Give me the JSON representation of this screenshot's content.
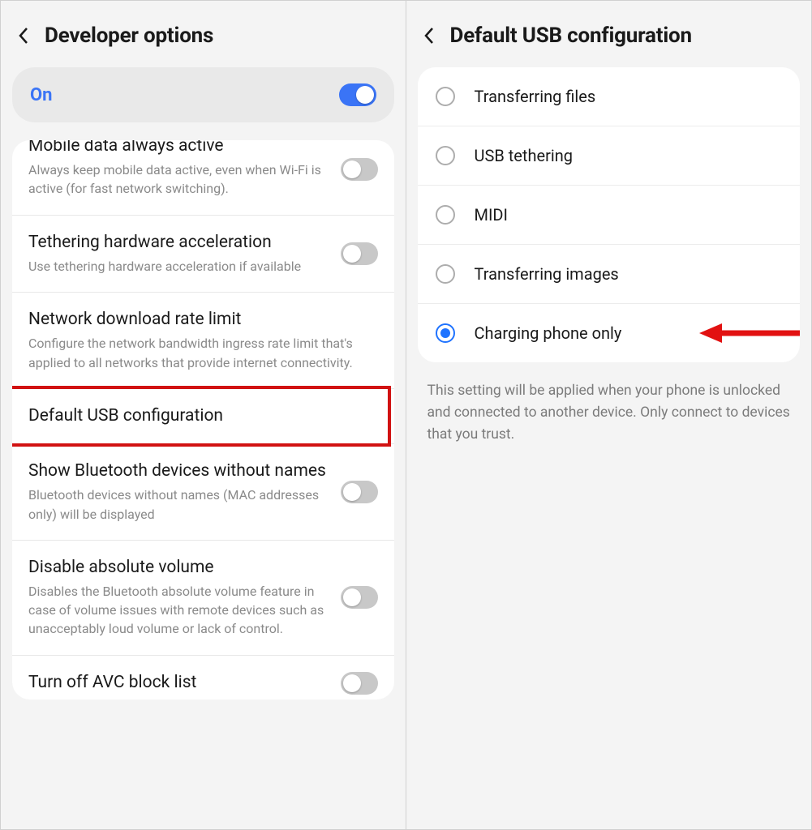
{
  "left": {
    "title": "Developer options",
    "on_label": "On",
    "on_state": true,
    "rows": {
      "mobile_data": {
        "title": "Mobile data always active",
        "sub": "Always keep mobile data active, even when Wi-Fi is active (for fast network switching).",
        "toggle": false
      },
      "tether_accel": {
        "title": "Tethering hardware acceleration",
        "sub": "Use tethering hardware acceleration if available",
        "toggle": false
      },
      "net_rate": {
        "title": "Network download rate limit",
        "sub": "Configure the network bandwidth ingress rate limit that's applied to all networks that provide internet connectivity."
      },
      "default_usb": {
        "title": "Default USB configuration"
      },
      "bt_noname": {
        "title": "Show Bluetooth devices without names",
        "sub": "Bluetooth devices without names (MAC addresses only) will be displayed",
        "toggle": false
      },
      "abs_vol": {
        "title": "Disable absolute volume",
        "sub": "Disables the Bluetooth absolute volume feature in case of volume issues with remote devices such as unacceptably loud volume or lack of control.",
        "toggle": false
      },
      "avc": {
        "title": "Turn off AVC block list",
        "toggle": false
      }
    }
  },
  "right": {
    "title": "Default USB configuration",
    "options": {
      "files": {
        "label": "Transferring files",
        "checked": false
      },
      "tether": {
        "label": "USB tethering",
        "checked": false
      },
      "midi": {
        "label": "MIDI",
        "checked": false
      },
      "images": {
        "label": "Transferring images",
        "checked": false
      },
      "charge": {
        "label": "Charging phone only",
        "checked": true
      }
    },
    "footer": "This setting will be applied when your phone is unlocked and connected to another device. Only connect to devices that you trust."
  }
}
